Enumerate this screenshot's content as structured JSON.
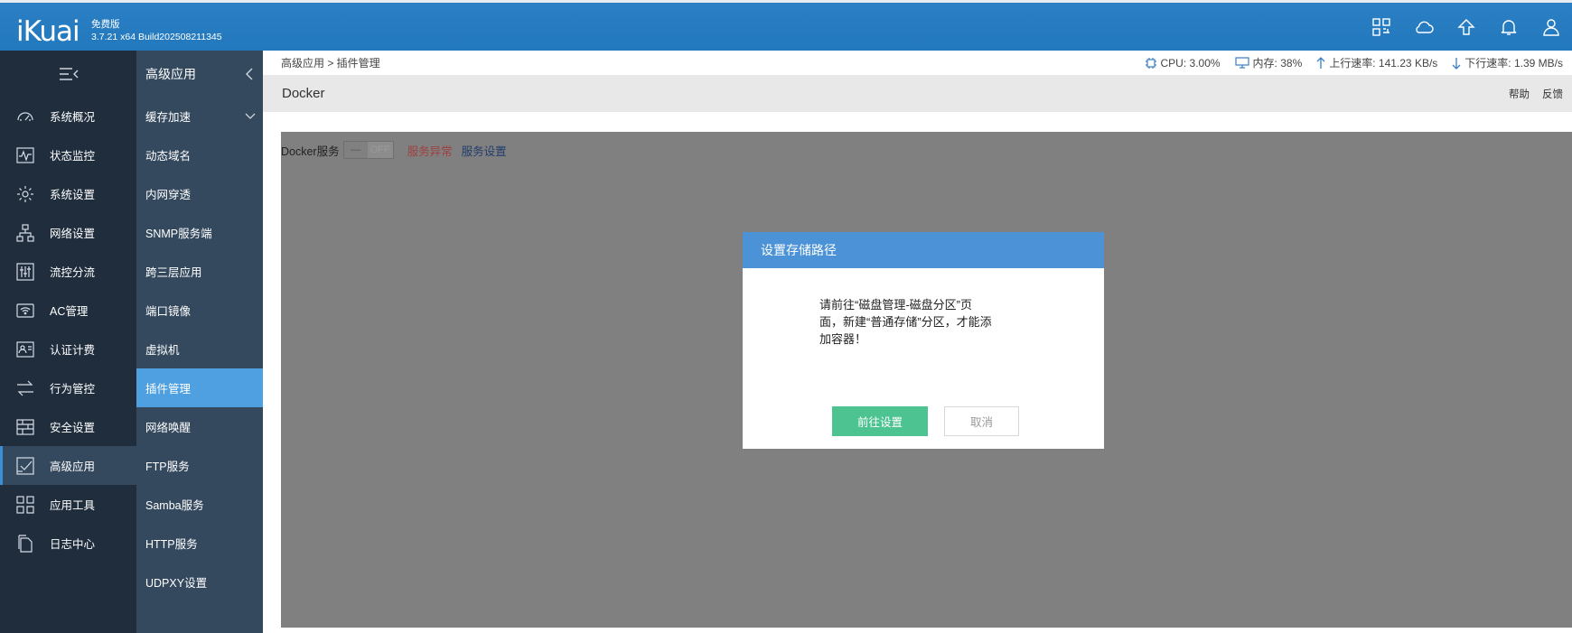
{
  "brand": {
    "logo": "iKuai",
    "edition": "免费版",
    "version": "3.7.21 x64 Build202508211345"
  },
  "top_icons": [
    "apps-grid-icon",
    "cloud-icon",
    "upgrade-icon",
    "bell-icon",
    "user-icon"
  ],
  "nav_primary": [
    {
      "label": "系统概况",
      "icon": "dashboard-icon"
    },
    {
      "label": "状态监控",
      "icon": "monitor-icon"
    },
    {
      "label": "系统设置",
      "icon": "gear-icon"
    },
    {
      "label": "网络设置",
      "icon": "network-icon"
    },
    {
      "label": "流控分流",
      "icon": "sliders-icon"
    },
    {
      "label": "AC管理",
      "icon": "wifi-ap-icon"
    },
    {
      "label": "认证计费",
      "icon": "id-card-icon"
    },
    {
      "label": "行为管控",
      "icon": "arrows-icon"
    },
    {
      "label": "安全设置",
      "icon": "firewall-icon"
    },
    {
      "label": "高级应用",
      "icon": "check-box-icon",
      "active": true
    },
    {
      "label": "应用工具",
      "icon": "tools-grid-icon"
    },
    {
      "label": "日志中心",
      "icon": "document-icon"
    }
  ],
  "nav_secondary": {
    "title": "高级应用",
    "items": [
      {
        "label": "缓存加速",
        "has_submenu": true
      },
      {
        "label": "动态域名"
      },
      {
        "label": "内网穿透"
      },
      {
        "label": "SNMP服务端"
      },
      {
        "label": "跨三层应用"
      },
      {
        "label": "端口镜像"
      },
      {
        "label": "虚拟机"
      },
      {
        "label": "插件管理",
        "active": true
      },
      {
        "label": "网络唤醒"
      },
      {
        "label": "FTP服务"
      },
      {
        "label": "Samba服务"
      },
      {
        "label": "HTTP服务"
      },
      {
        "label": "UDPXY设置"
      }
    ]
  },
  "breadcrumb": "高级应用 > 插件管理",
  "stats": {
    "cpu": "CPU: 3.00%",
    "memory": "内存: 38%",
    "upload": "上行速率: 141.23 KB/s",
    "download": "下行速率: 1.39 MB/s"
  },
  "page": {
    "title": "Docker",
    "help": "帮助",
    "feedback": "反馈"
  },
  "service": {
    "label": "Docker服务",
    "toggle_knob": "—",
    "toggle_state": "OFF",
    "status": "服务异常",
    "settings_link": "服务设置"
  },
  "modal": {
    "title": "设置存储路径",
    "message_lines": [
      "请前往“磁盘管理-磁盘分区”页",
      "面，新建“普通存储”分区，才能添",
      "加容器！"
    ],
    "confirm": "前往设置",
    "cancel": "取消"
  },
  "colors": {
    "topbar": "#2379bd",
    "nav_dark": "#1f2d3d",
    "nav_mid": "#34495e",
    "active_item": "#4fa0e0",
    "confirm_button": "#4cc391",
    "modal_header": "#4b92d6",
    "overlay": "#808080"
  }
}
